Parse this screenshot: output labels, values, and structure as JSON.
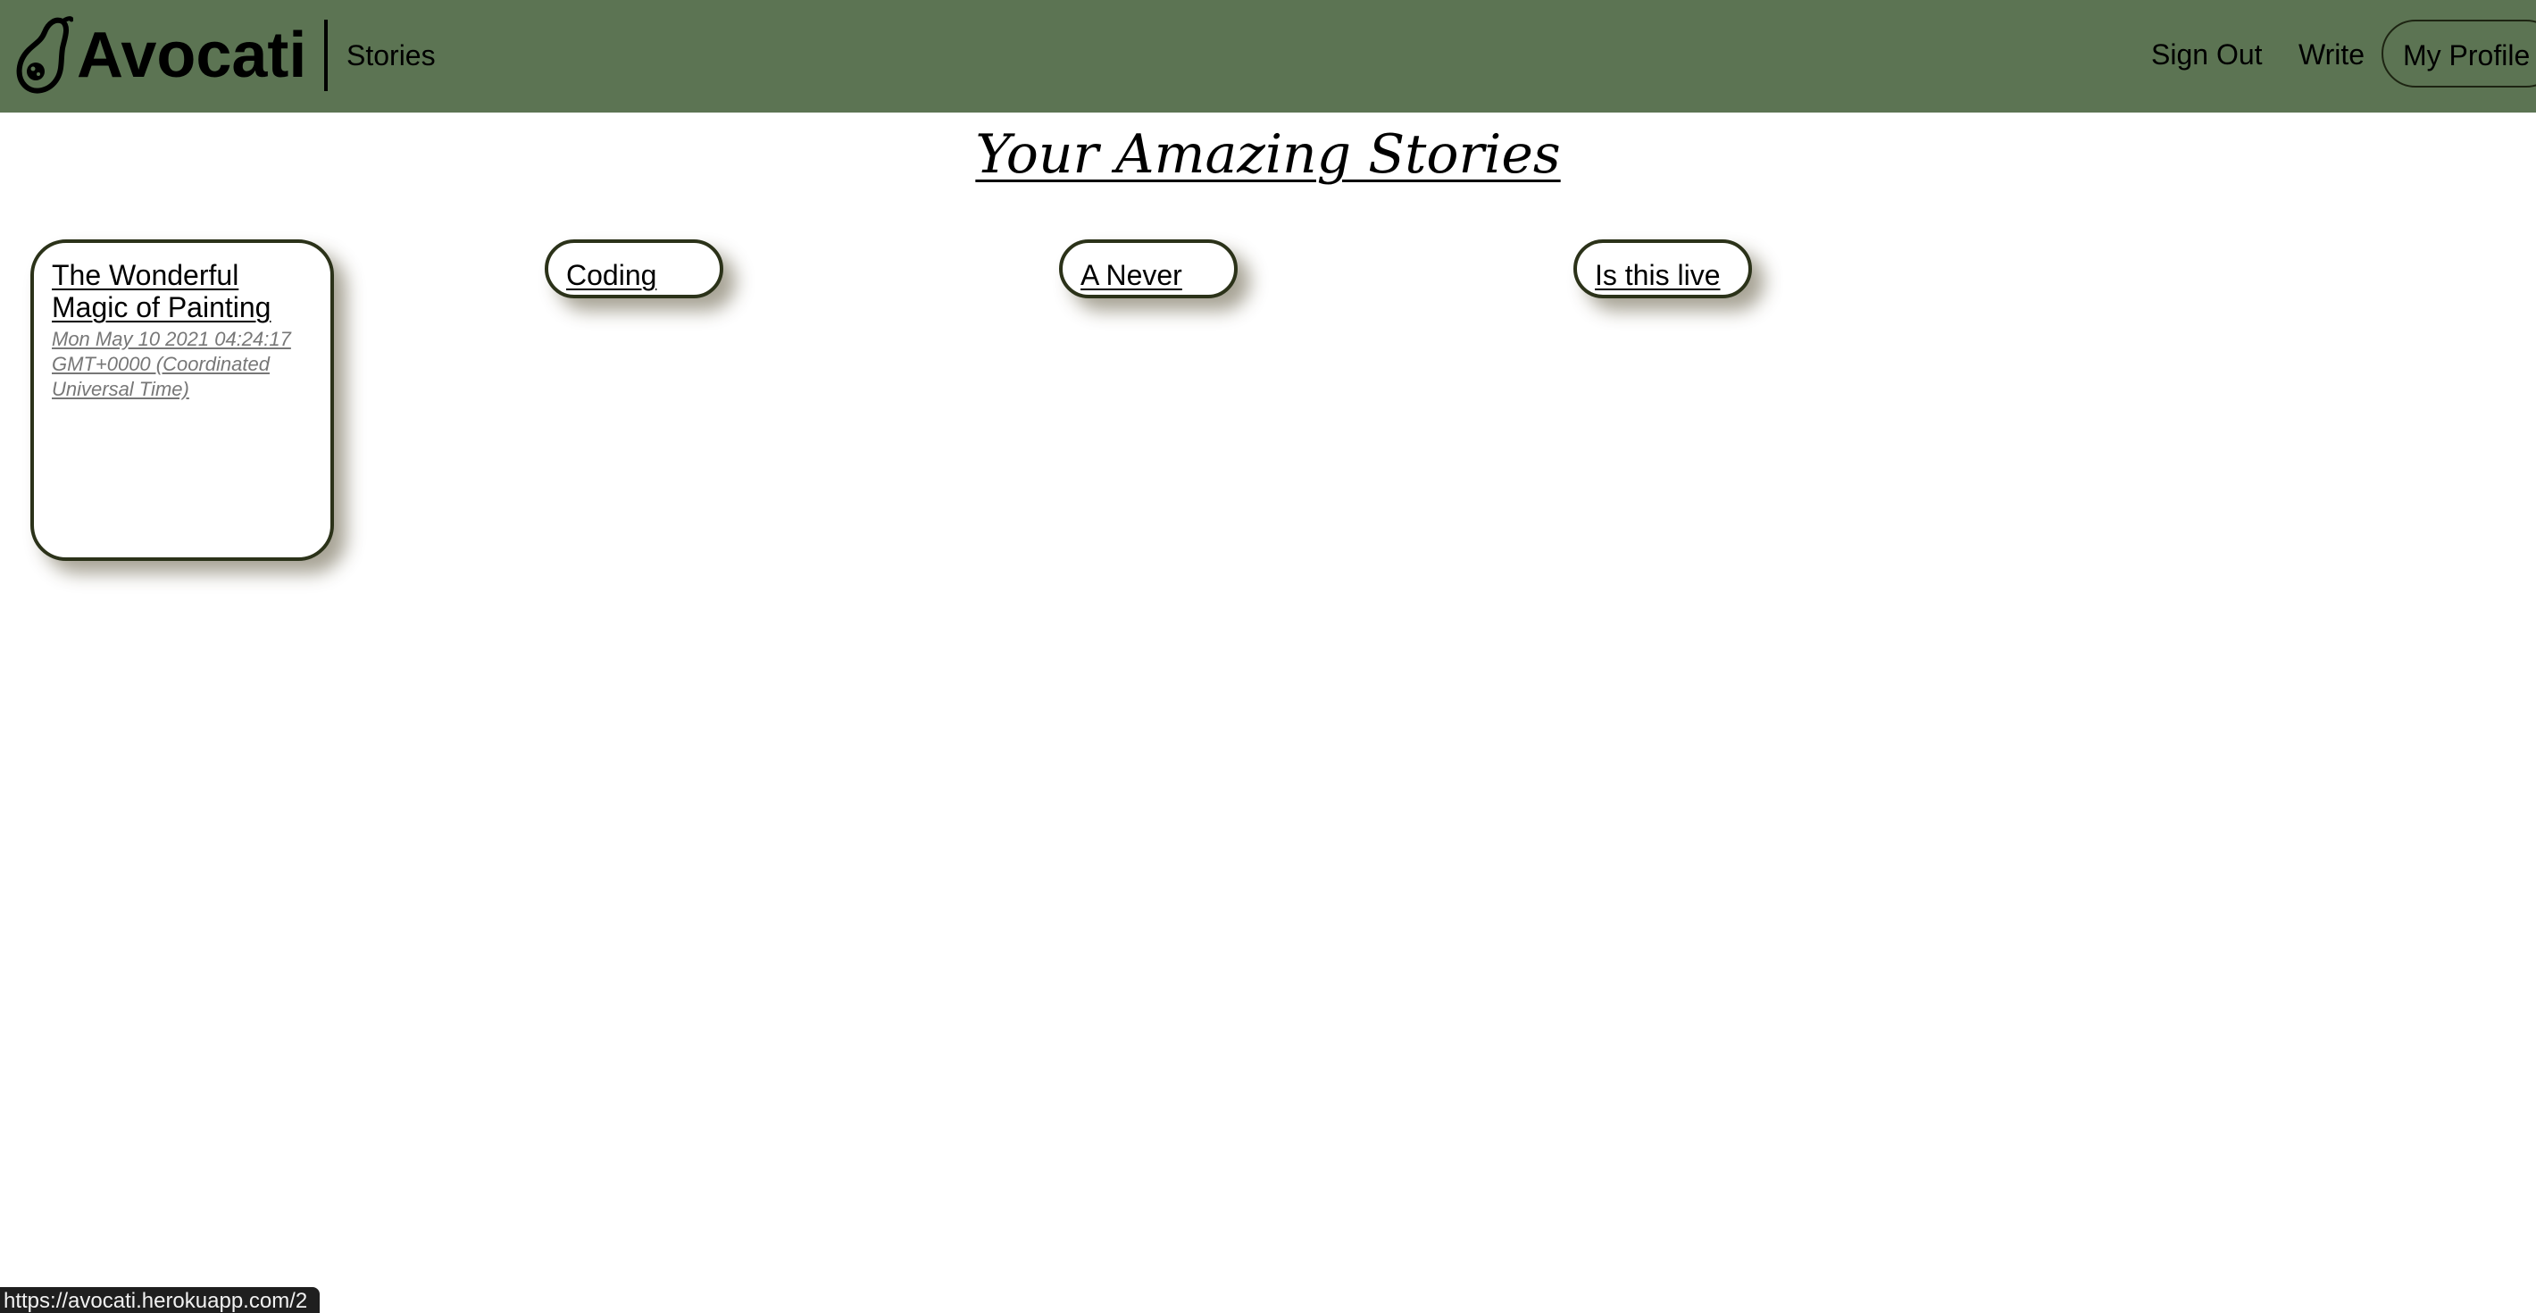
{
  "navbar": {
    "brand": "Avocati",
    "logo_icon": "avocado-icon",
    "stories_label": "Stories",
    "signout_label": "Sign Out",
    "write_label": "Write",
    "profile_label": "My Profile",
    "background_color": "#5c7453"
  },
  "main": {
    "title": "Your Amazing Stories",
    "stories": [
      {
        "title": "The Wonderful Magic of Painting",
        "date": "Mon May 10 2021 04:24:17 GMT+0000 (Coordinated Universal Time)"
      },
      {
        "title": "Coding"
      },
      {
        "title": "A Never"
      },
      {
        "title": "Is this live"
      }
    ]
  },
  "status_bar": {
    "url": "https://avocati.herokuapp.com/2"
  }
}
